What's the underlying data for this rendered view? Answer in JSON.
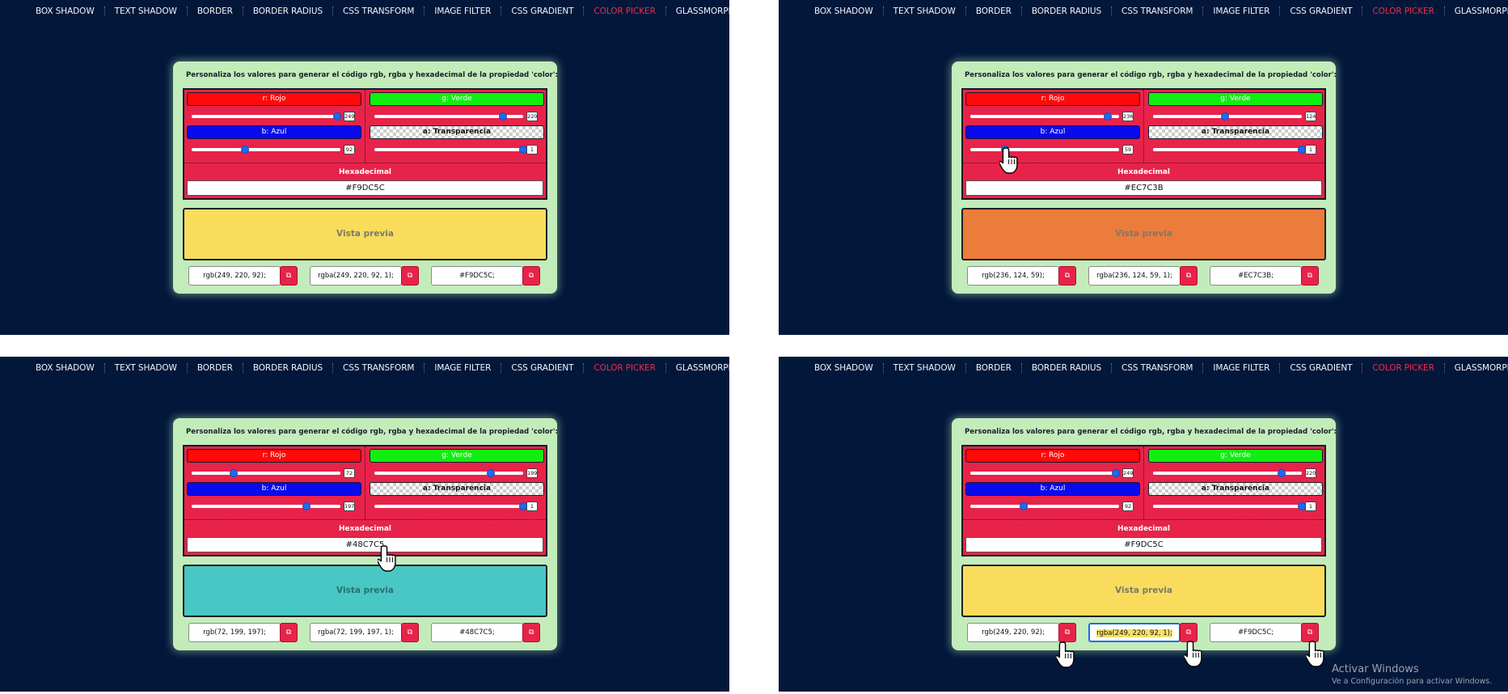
{
  "nav": [
    "BOX SHADOW",
    "TEXT SHADOW",
    "BORDER",
    "BORDER RADIUS",
    "CSS TRANSFORM",
    "IMAGE FILTER",
    "CSS GRADIENT",
    "COLOR PICKER",
    "GLASSMORPHISM"
  ],
  "nav_active": "COLOR PICKER",
  "card_title": "Personaliza los valores para generar el código rgb, rgba y hexadecimal de la propiedad 'color':",
  "labels": {
    "red": "r: Rojo",
    "green": "g: Verde",
    "blue": "b: Azul",
    "alpha": "a: Transparencia",
    "hex": "Hexadecimal",
    "preview": "Vista previa"
  },
  "colors": {
    "accent": "#E8234A",
    "navy_background": "#02173A",
    "card_background": "#C3ECBB",
    "nav_active": "#EF2B4E"
  },
  "panels": [
    {
      "r": "249",
      "g": "220",
      "b": "92",
      "a": "1",
      "hex": "#F9DC5C",
      "color": "#F9DC5C",
      "rgb": "rgb(249, 220, 92);",
      "rgba": "rgba(249, 220, 92, 1);",
      "hex_out": "#F9DC5C;"
    },
    {
      "r": "236",
      "g": "124",
      "b": "59",
      "a": "1",
      "hex": "#EC7C3B",
      "color": "#EC7C3B",
      "rgb": "rgb(236, 124, 59);",
      "rgba": "rgba(236, 124, 59, 1);",
      "hex_out": "#EC7C3B;"
    },
    {
      "r": "72",
      "g": "199",
      "b": "197",
      "a": "1",
      "hex": "#48C7C5",
      "color": "#48C7C5",
      "rgb": "rgb(72, 199, 197);",
      "rgba": "rgba(72, 199, 197, 1);",
      "hex_out": "#48C7C5;"
    },
    {
      "r": "249",
      "g": "220",
      "b": "92",
      "a": "1",
      "hex": "#F9DC5C",
      "color": "#F9DC5C",
      "rgb": "rgb(249, 220, 92);",
      "rgba": "rgba(249, 220, 92, 1);",
      "hex_out": "#F9DC5C;"
    }
  ],
  "copy_icon": "copy-icon",
  "windows_watermark": {
    "title": "Activar Windows",
    "subtitle": "Ve a Configuración para activar Windows."
  }
}
